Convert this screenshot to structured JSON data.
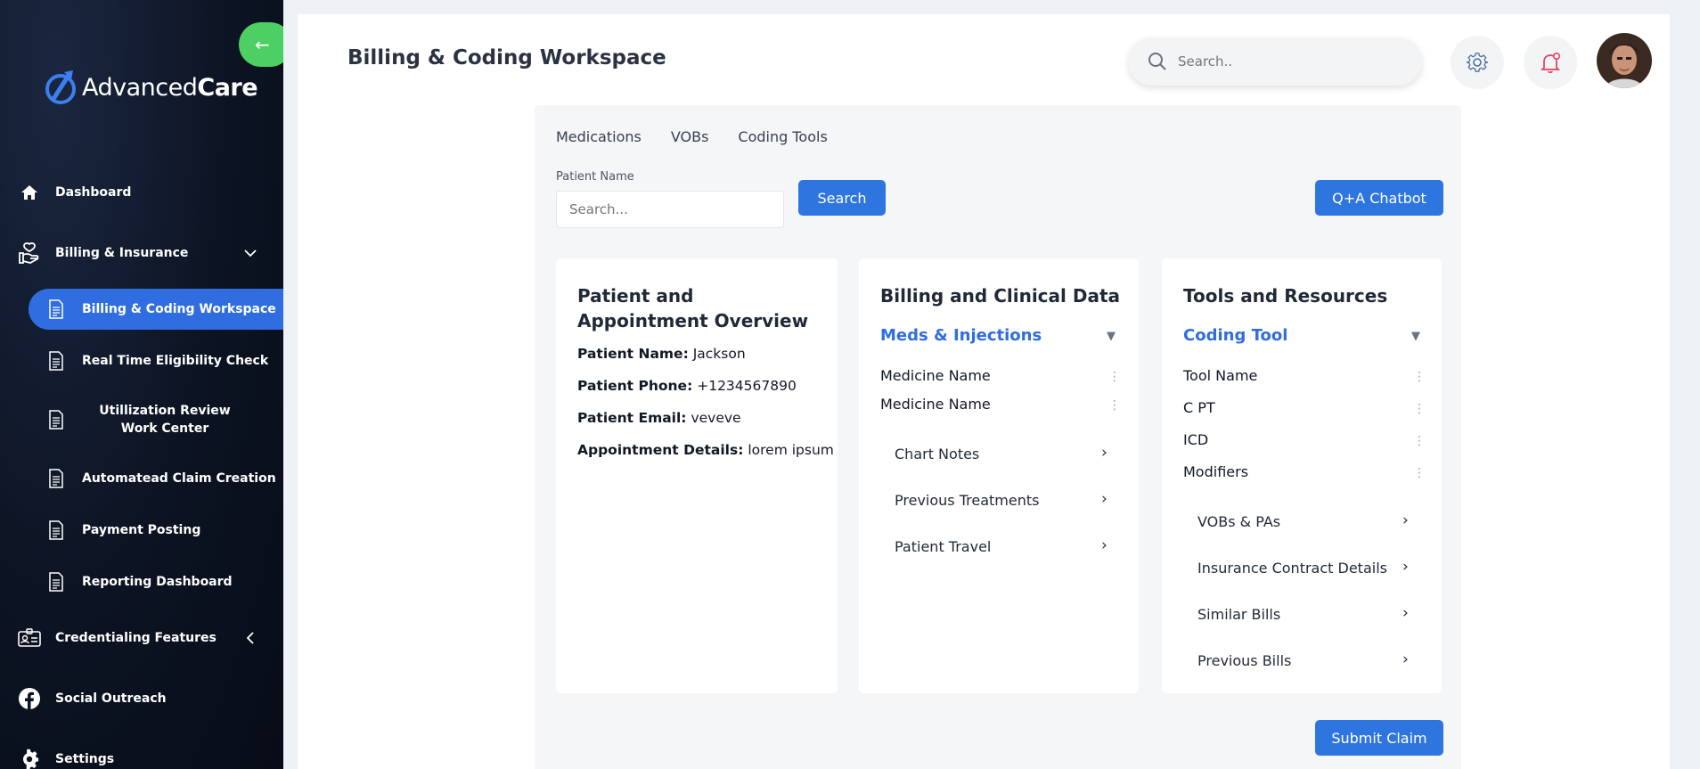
{
  "sidebar": {
    "brand": {
      "part1": "Advanced",
      "part2": "Care"
    },
    "items": [
      {
        "label": "Dashboard",
        "icon": "home-icon"
      },
      {
        "label": "Billing & Insurance",
        "icon": "hand-heart-icon"
      },
      {
        "label": "Credentialing Features",
        "icon": "id-card-icon"
      },
      {
        "label": "Social Outreach",
        "icon": "facebook-icon"
      },
      {
        "label": "Settings",
        "icon": "gear-icon"
      }
    ],
    "sub_items": [
      {
        "label": "Billing & Coding Workspace",
        "active": true
      },
      {
        "label": "Real Time Eligibility Check"
      },
      {
        "label": "Utillization Review Work Center"
      },
      {
        "label": "Automatead Claim Creation"
      },
      {
        "label": "Payment Posting"
      },
      {
        "label": "Reporting Dashboard"
      }
    ]
  },
  "header": {
    "title": "Billing & Coding Workspace",
    "search_placeholder": "Search.."
  },
  "workspace": {
    "tabs": [
      "Medications",
      "VOBs",
      "Coding Tools"
    ],
    "patient_label": "Patient Name",
    "patient_placeholder": "Search...",
    "search_button": "Search",
    "chatbot_button": "Q+A Chatbot",
    "submit_button": "Submit Claim"
  },
  "overview": {
    "title": "Patient and Appointment Overview",
    "fields": [
      {
        "label": "Patient Name:",
        "value": "Jackson"
      },
      {
        "label": "Patient Phone:",
        "value": "+1234567890"
      },
      {
        "label": "Patient Email:",
        "value": "veveve"
      },
      {
        "label": "Appointment Details:",
        "value": "lorem ipsum"
      }
    ]
  },
  "billing": {
    "title": "Billing and Clinical Data",
    "accordion": "Meds & Injections",
    "rows": [
      "Medicine Name",
      "Medicine Name"
    ],
    "links": [
      "Chart Notes",
      "Previous Treatments",
      "Patient Travel"
    ]
  },
  "tools": {
    "title": "Tools and Resources",
    "accordion": "Coding Tool",
    "rows": [
      "Tool Name",
      "C PT",
      "ICD",
      "Modifiers"
    ],
    "links": [
      "VOBs & PAs",
      "Insurance Contract Details",
      "Similar Bills",
      "Previous Bills"
    ]
  },
  "glyphs": {
    "caret": "▼",
    "arrow": "›",
    "kebab": "⋮",
    "back": "←"
  }
}
